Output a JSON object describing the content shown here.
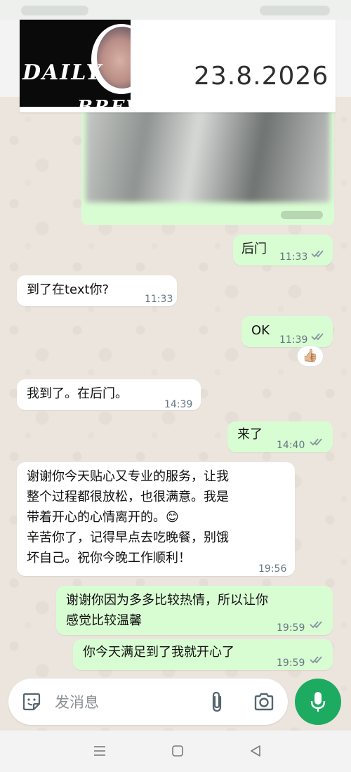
{
  "overlay": {
    "logo_line_1": "DAILY",
    "logo_line_2": "BREW",
    "date": "23.8.2026"
  },
  "messages": [
    {
      "text": "后门",
      "time": "11:33",
      "direction": "out",
      "read": true
    },
    {
      "text": "到了在text你?",
      "time": "11:33",
      "direction": "in"
    },
    {
      "text": "OK",
      "time": "11:39",
      "direction": "out",
      "read": true,
      "reaction": "👍🏼"
    },
    {
      "text": "我到了。在后门。",
      "time": "14:39",
      "direction": "in"
    },
    {
      "text": "来了",
      "time": "14:40",
      "direction": "out",
      "read": true
    },
    {
      "text": "谢谢你今天贴心又专业的服务，让我\n整个过程都很放松，也很满意。我是\n带着开心的心情离开的。😊\n辛苦你了，记得早点去吃晚餐，别饿\n坏自己。祝你今晚工作顺利！",
      "time": "19:56",
      "direction": "in"
    },
    {
      "text": "谢谢你因为多多比较热情，所以让你\n感觉比较温馨",
      "time": "19:59",
      "direction": "out",
      "read": true
    },
    {
      "text": "你今天满足到了我就开心了",
      "time": "19:59",
      "direction": "out",
      "read": true
    }
  ],
  "composer": {
    "placeholder": "发消息",
    "icons": [
      "sticker-icon",
      "paperclip-icon",
      "camera-icon",
      "microphone-icon"
    ]
  },
  "navigation": {
    "icons": [
      "menu-icon",
      "home-square-icon",
      "back-triangle-icon"
    ]
  },
  "colors": {
    "outgoing_bubble": "#d9fdd3",
    "incoming_bubble": "#ffffff",
    "read_ticks": "#53bdeb",
    "mic_button": "#1daa61",
    "wallpaper": "#ece5dd"
  }
}
